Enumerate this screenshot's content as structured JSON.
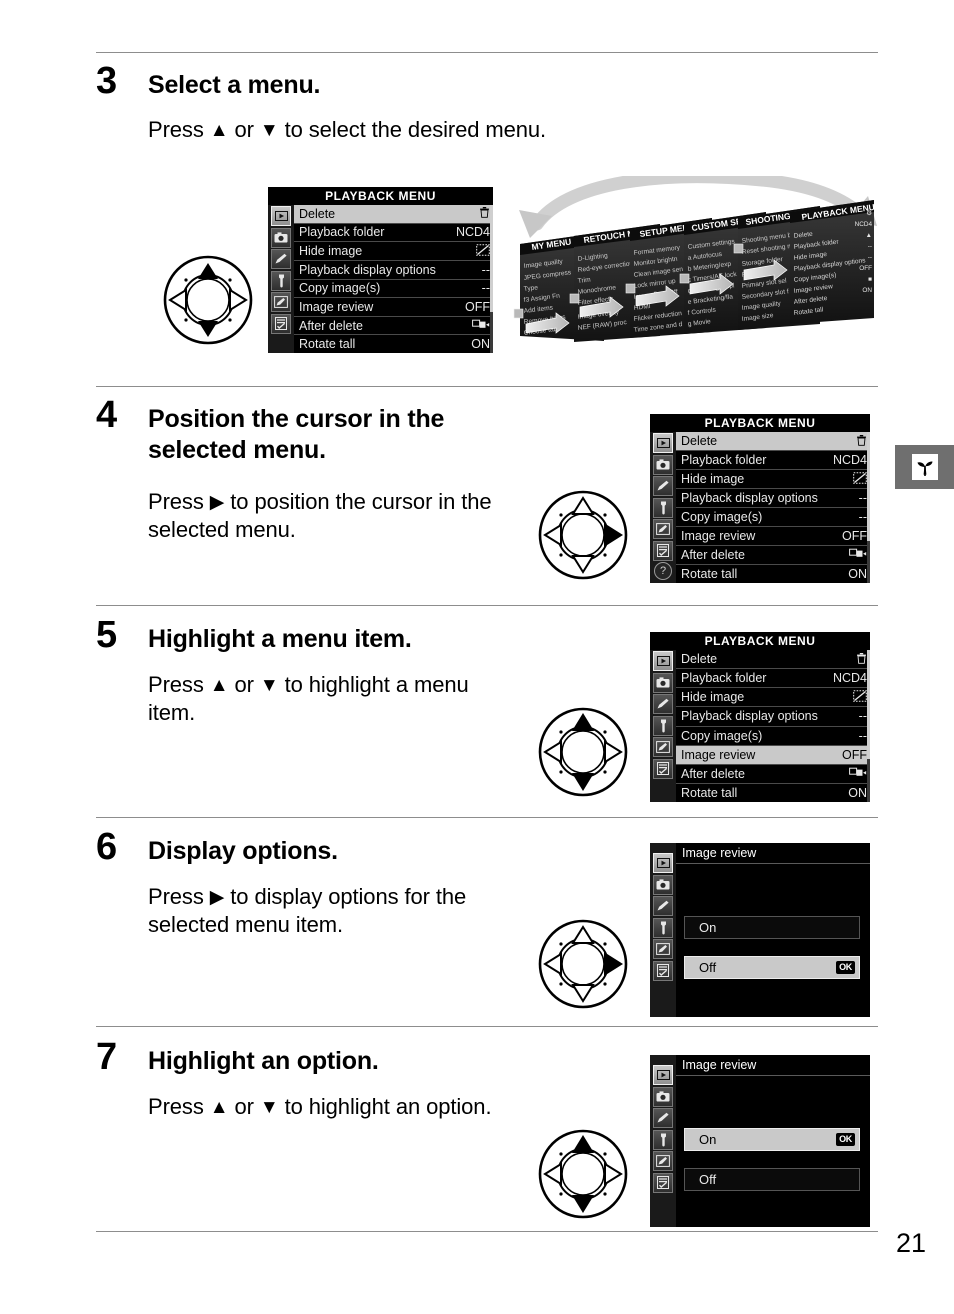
{
  "page": {
    "number": "21"
  },
  "side_tab": {
    "icon": "seedling-icon"
  },
  "steps": [
    {
      "number": "3",
      "title": "Select a menu.",
      "body_pre": "Press ",
      "body_up": "▲",
      "body_mid": " or ",
      "body_down": "▼",
      "body_post": " to select the desired menu."
    },
    {
      "number": "4",
      "title": "Position the cursor in the selected menu.",
      "body_pre": "Press ",
      "body_arrow": "▶",
      "body_post": " to position the cursor in the selected menu."
    },
    {
      "number": "5",
      "title": "Highlight a menu item.",
      "body_pre": "Press ",
      "body_up": "▲",
      "body_mid": " or ",
      "body_down": "▼",
      "body_post": " to highlight a menu item."
    },
    {
      "number": "6",
      "title": "Display options.",
      "body_pre": "Press ",
      "body_arrow": "▶",
      "body_post": " to display options for the selected menu item."
    },
    {
      "number": "7",
      "title": "Highlight an option.",
      "body_pre": "Press ",
      "body_up": "▲",
      "body_mid": " or ",
      "body_down": "▼",
      "body_post": " to highlight an option."
    }
  ],
  "playback_menu": {
    "title": "PLAYBACK MENU",
    "sidebar_icons": [
      "playback-icon",
      "shooting-camera-icon",
      "custom-setting-pencil-icon",
      "setup-wrench-icon",
      "retouch-brush-icon",
      "my-menu-checklist-icon"
    ],
    "help_label": "?",
    "rows": [
      {
        "label": "Delete",
        "value": "trash-icon",
        "value_text": ""
      },
      {
        "label": "Playback folder",
        "value": "text",
        "value_text": "NCD4"
      },
      {
        "label": "Hide image",
        "value": "hide-icon",
        "value_text": ""
      },
      {
        "label": "Playback display options",
        "value": "text",
        "value_text": "--"
      },
      {
        "label": "Copy image(s)",
        "value": "text",
        "value_text": "--"
      },
      {
        "label": "Image review",
        "value": "text",
        "value_text": "OFF"
      },
      {
        "label": "After delete",
        "value": "after-icon",
        "value_text": ""
      },
      {
        "label": "Rotate tall",
        "value": "text",
        "value_text": "ON"
      }
    ]
  },
  "menus_step3": {
    "highlighted_row_index": 0,
    "note": "no help icon in step 3 panel"
  },
  "menus_step4": {
    "highlighted_row_index": 0
  },
  "menus_step5": {
    "highlighted_row_index": 5
  },
  "image_review_dialog": {
    "title": "Image review",
    "options": [
      {
        "label": "On"
      },
      {
        "label": "Off"
      }
    ],
    "ok_label": "OK",
    "step6_selected_index": 1,
    "step7_selected_index": 0
  },
  "carousel": {
    "panels": [
      {
        "title": "MY MENU",
        "items": [
          "Image quality",
          "JPEG compress",
          "Type",
          "f3 Assign Fn",
          "Add items",
          "Remove items",
          "Choose tab"
        ]
      },
      {
        "title": "RETOUCH MENU",
        "items": [
          "D-Lighting",
          "Red-eye correction",
          "Trim",
          "Monochrome",
          "Filter effects",
          "Image overlay",
          "NEF (RAW) processing"
        ]
      },
      {
        "title": "SETUP MENU",
        "items": [
          "Format memory card",
          "Monitor brightness",
          "Clean image sensor",
          "Lock mirror up",
          "Image Dust Off",
          "HDMI",
          "Flicker reduction",
          "Time zone and date"
        ]
      },
      {
        "title": "CUSTOM SETTING MENU",
        "items": [
          "Custom settings",
          "a Autofocus",
          "b Metering/exposure",
          "c Timers/AE lock",
          "d Shooting/display",
          "e Bracketing/flash",
          "f Controls",
          "g Movie"
        ]
      },
      {
        "title": "SHOOTING MENU",
        "items": [
          "Shooting menu bank",
          "Reset shooting menu",
          "Storage folder",
          "File naming",
          "Primary slot selection",
          "Secondary slot function",
          "Image quality",
          "Image size"
        ]
      },
      {
        "title": "PLAYBACK MENU",
        "items": [
          "Delete",
          "Playback folder",
          "Hide image",
          "Playback display options",
          "Copy image(s)",
          "Image review",
          "After delete",
          "Rotate tall"
        ],
        "values": [
          "",
          "NCD4",
          "",
          "--",
          "--",
          "OFF",
          "",
          "ON"
        ]
      }
    ]
  }
}
